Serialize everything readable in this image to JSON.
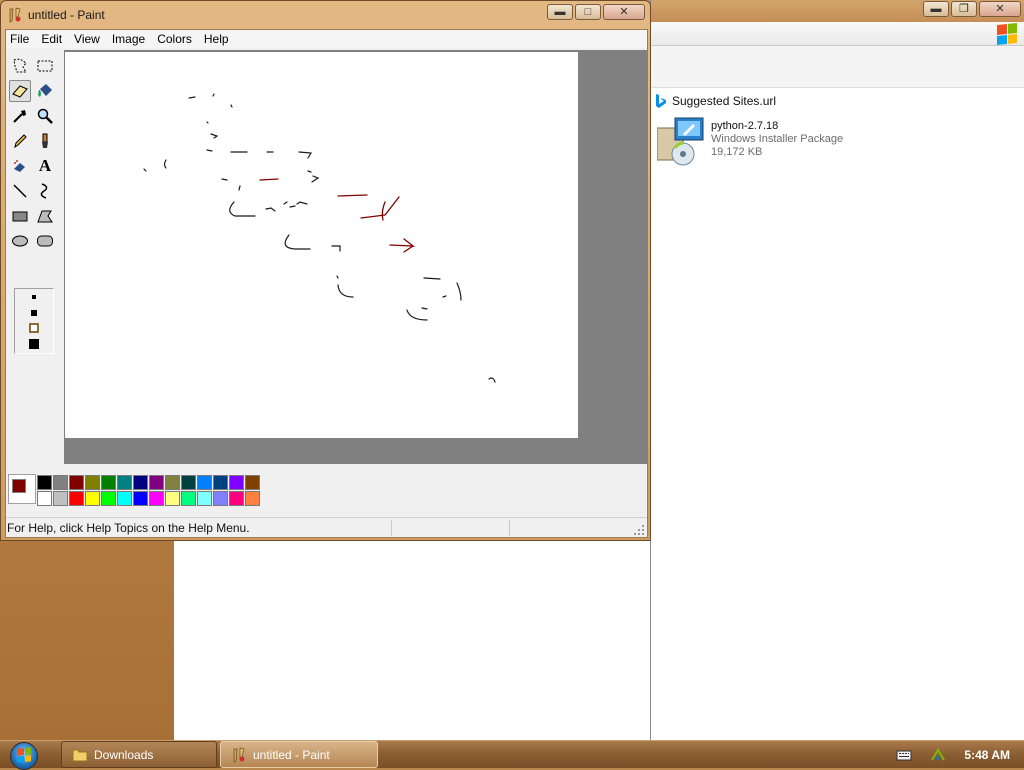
{
  "paint": {
    "title": "untitled - Paint",
    "menu": [
      "File",
      "Edit",
      "View",
      "Image",
      "Colors",
      "Help"
    ],
    "status": "For Help, click Help Topics on the Help Menu.",
    "tools": [
      {
        "name": "free-form-select-icon"
      },
      {
        "name": "select-icon"
      },
      {
        "name": "eraser-icon",
        "active": true
      },
      {
        "name": "fill-bucket-icon"
      },
      {
        "name": "pick-color-icon"
      },
      {
        "name": "magnifier-icon"
      },
      {
        "name": "pencil-icon"
      },
      {
        "name": "brush-icon"
      },
      {
        "name": "airbrush-icon"
      },
      {
        "name": "text-icon"
      },
      {
        "name": "line-icon"
      },
      {
        "name": "curve-icon"
      },
      {
        "name": "rectangle-icon"
      },
      {
        "name": "polygon-icon"
      },
      {
        "name": "ellipse-icon"
      },
      {
        "name": "rounded-rectangle-icon"
      }
    ],
    "text_tool_label": "A",
    "foreground_color": "#800000",
    "background_color": "#ffffff",
    "palette_top": [
      "#000000",
      "#808080",
      "#800000",
      "#808000",
      "#008000",
      "#008080",
      "#000080",
      "#800080",
      "#808040",
      "#004040",
      "#0080ff",
      "#004080",
      "#8000ff",
      "#804000"
    ],
    "palette_bottom": [
      "#ffffff",
      "#c0c0c0",
      "#ff0000",
      "#ffff00",
      "#00ff00",
      "#00ffff",
      "#0000ff",
      "#ff00ff",
      "#ffff80",
      "#00ff80",
      "#80ffff",
      "#8080ff",
      "#ff0080",
      "#ff8040"
    ]
  },
  "explorer": {
    "suggested_sites": "Suggested Sites.url",
    "file": {
      "name": "python-2.7.18",
      "type": "Windows Installer Package",
      "size": "19,172 KB"
    }
  },
  "taskbar": {
    "buttons": [
      {
        "label": "Downloads",
        "icon": "folder-icon"
      },
      {
        "label": "untitled - Paint",
        "icon": "paint-icon",
        "active": true
      }
    ],
    "clock": "5:48 AM"
  }
}
